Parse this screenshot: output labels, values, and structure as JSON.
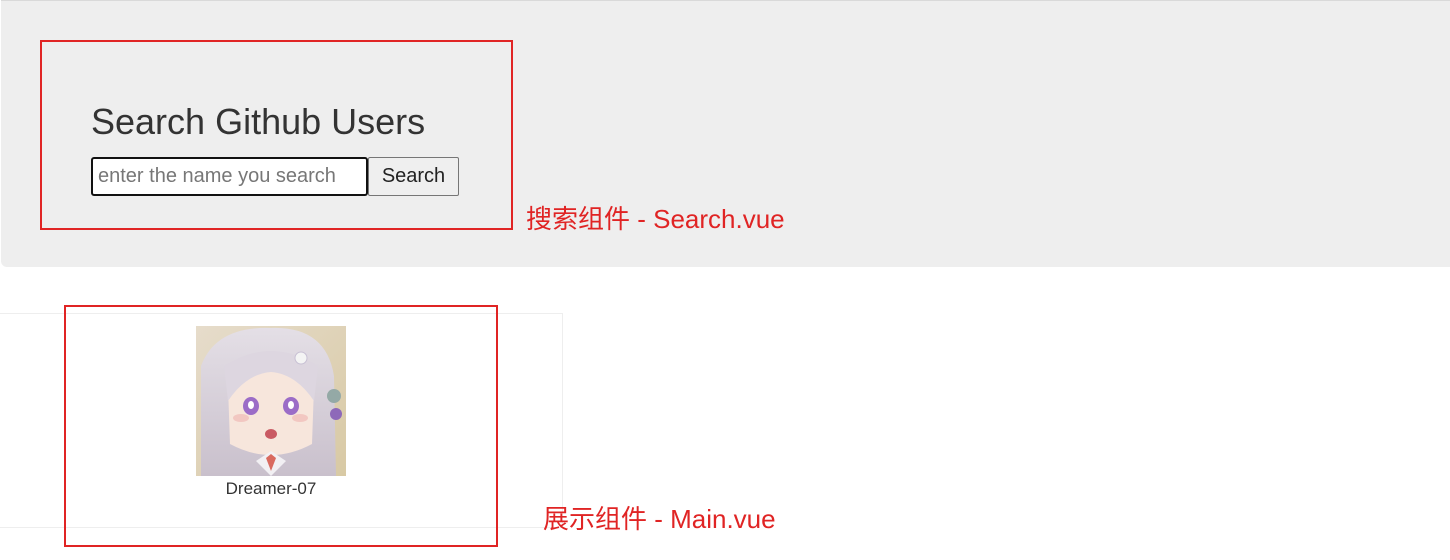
{
  "header": {
    "title": "Search Github Users"
  },
  "search": {
    "placeholder": "enter the name you search",
    "value": "",
    "button_label": "Search"
  },
  "annotations": {
    "search_component": "搜索组件 - Search.vue",
    "main_component": "展示组件 - Main.vue",
    "color": "#e02424"
  },
  "results": {
    "users": [
      {
        "login": "Dreamer-07",
        "avatar_icon": "anime-avatar-image"
      }
    ]
  },
  "colors": {
    "jumbotron_bg": "#eeeeee",
    "text": "#333333",
    "annotation": "#e02424"
  }
}
